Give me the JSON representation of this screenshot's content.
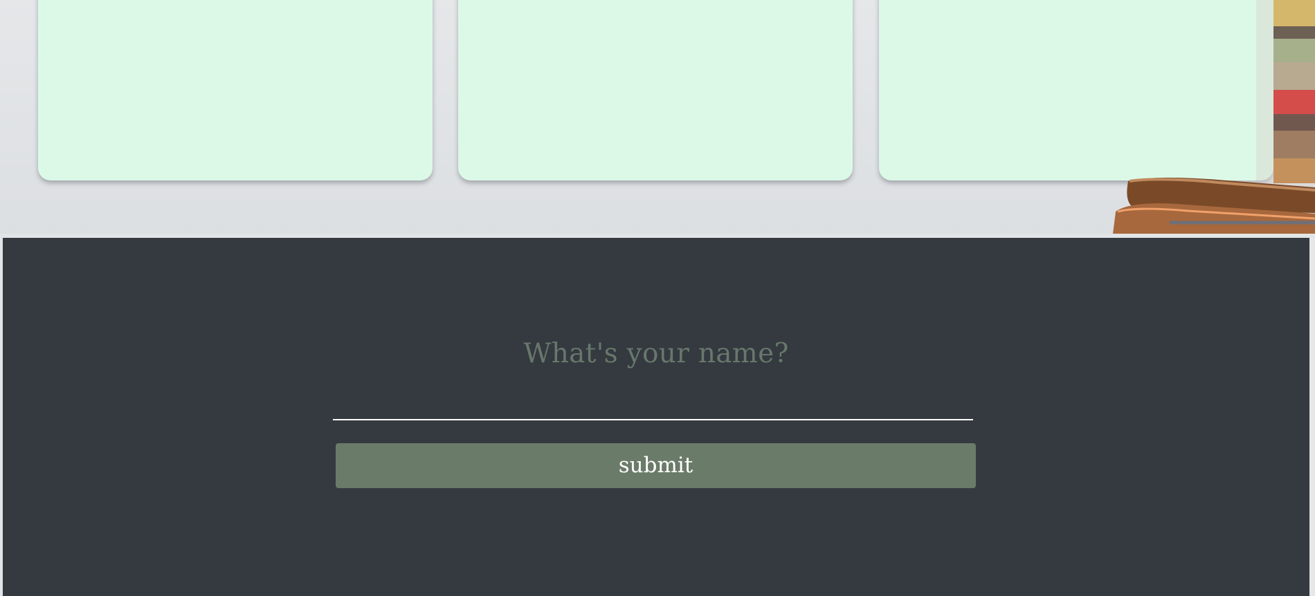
{
  "page": {
    "background_color": "#e2e5e7"
  },
  "cards": [
    {
      "background_color": "#dcf9e8"
    },
    {
      "background_color": "#dcf9e8"
    },
    {
      "background_color": "#dcf9e8"
    }
  ],
  "form": {
    "prompt": "What's your name?",
    "input_value": "",
    "submit_label": "submit",
    "background_color": "#343a40",
    "prompt_color": "#68776b",
    "button_color": "#6b7b69",
    "input_underline_color": "#ffffff"
  },
  "decorations": {
    "books_icon": "books-stack-icon"
  }
}
